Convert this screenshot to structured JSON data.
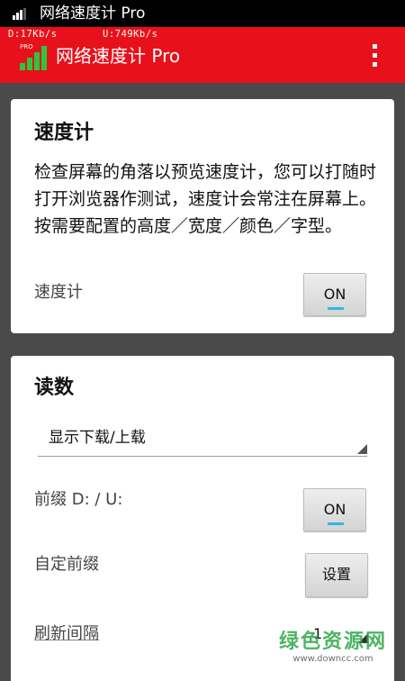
{
  "status_bar": {
    "title": "网络速度计 Pro",
    "signal_icon": "signal-icon"
  },
  "app_bar": {
    "title": "网络速度计 Pro",
    "download_speed": "D:17Kb/s",
    "upload_speed": "U:749Kb/s",
    "icon_badge": "PRO",
    "icon": "signal-bars-icon",
    "menu_icon": "overflow-menu-icon",
    "color": "#e8101a"
  },
  "speedometer_card": {
    "title": "速度计",
    "description": "检查屏幕的角落以预览速度计，您可以打随时打开浏览器作测试，速度计会常注在屏幕上。按需要配置的高度／宽度／颜色／字型。",
    "toggle_label": "速度计",
    "toggle_value": "ON"
  },
  "readings_card": {
    "title": "读数",
    "display_mode": {
      "selected": "显示下载/上载"
    },
    "prefix": {
      "label": "前缀 D: / U:",
      "value": "ON"
    },
    "custom_prefix": {
      "label": "自定前缀",
      "button": "设置"
    },
    "refresh_interval": {
      "label": "刷新间隔",
      "value": "1"
    }
  },
  "watermark": {
    "main": "绿色资源网",
    "sub": "www.downcc.com"
  },
  "colors": {
    "toggle_indicator": "#33b5e5",
    "background": "#4a4a4a"
  }
}
